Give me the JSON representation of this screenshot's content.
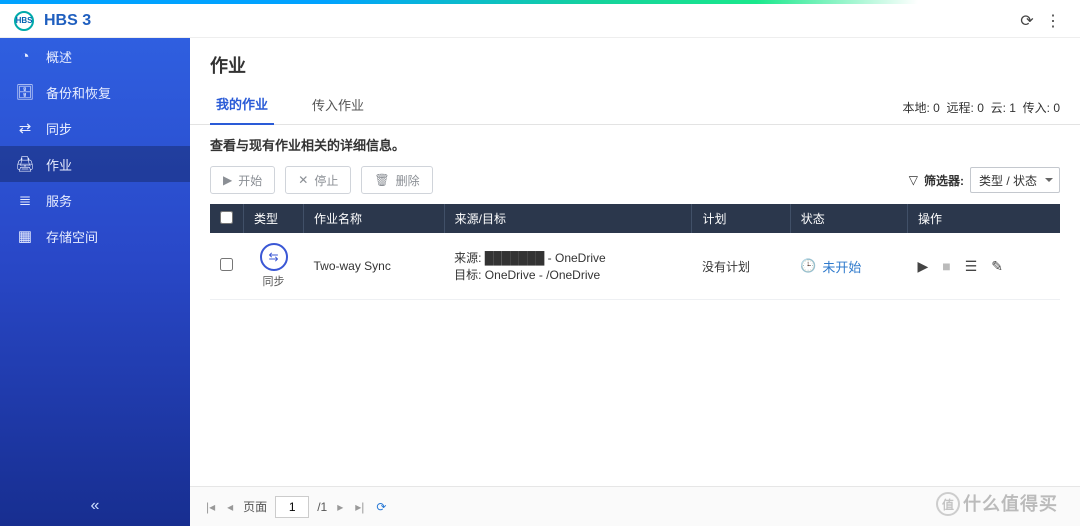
{
  "app": {
    "title": "HBS 3",
    "logo_text": "HBS"
  },
  "sidebar": {
    "items": [
      {
        "label": "概述",
        "icon": "◔"
      },
      {
        "label": "备份和恢复",
        "icon": "🗄"
      },
      {
        "label": "同步",
        "icon": "⇄"
      },
      {
        "label": "作业",
        "icon": "🖨"
      },
      {
        "label": "服务",
        "icon": "≣"
      },
      {
        "label": "存储空间",
        "icon": "▦"
      }
    ],
    "active_index": 3,
    "collapse_glyph": "«"
  },
  "page": {
    "title": "作业",
    "description": "查看与现有作业相关的详细信息。"
  },
  "tabs": {
    "items": [
      {
        "label": "我的作业"
      },
      {
        "label": "传入作业"
      }
    ],
    "active_index": 0
  },
  "counts": {
    "local_label": "本地",
    "local": 0,
    "remote_label": "远程",
    "remote": 0,
    "cloud_label": "云",
    "cloud": 1,
    "in_label": "传入",
    "in": 0
  },
  "toolbar": {
    "start": "开始",
    "stop": "停止",
    "delete": "删除",
    "filter_label": "筛选器:",
    "filter_value": "类型 / 状态"
  },
  "table": {
    "headers": {
      "type": "类型",
      "name": "作业名称",
      "src": "来源/目标",
      "plan": "计划",
      "status": "状态",
      "ops": "操作"
    },
    "rows": [
      {
        "type_label": "同步",
        "name": "Two-way Sync",
        "source": "来源: ███████ - OneDrive",
        "dest": "目标: OneDrive - /OneDrive",
        "plan": "没有计划",
        "status": "未开始"
      }
    ]
  },
  "pager": {
    "page_label": "页面",
    "page": "1",
    "total": "/1",
    "refresh_glyph": "⟳"
  },
  "watermark": {
    "text": "什么值得买",
    "badge": "值"
  }
}
